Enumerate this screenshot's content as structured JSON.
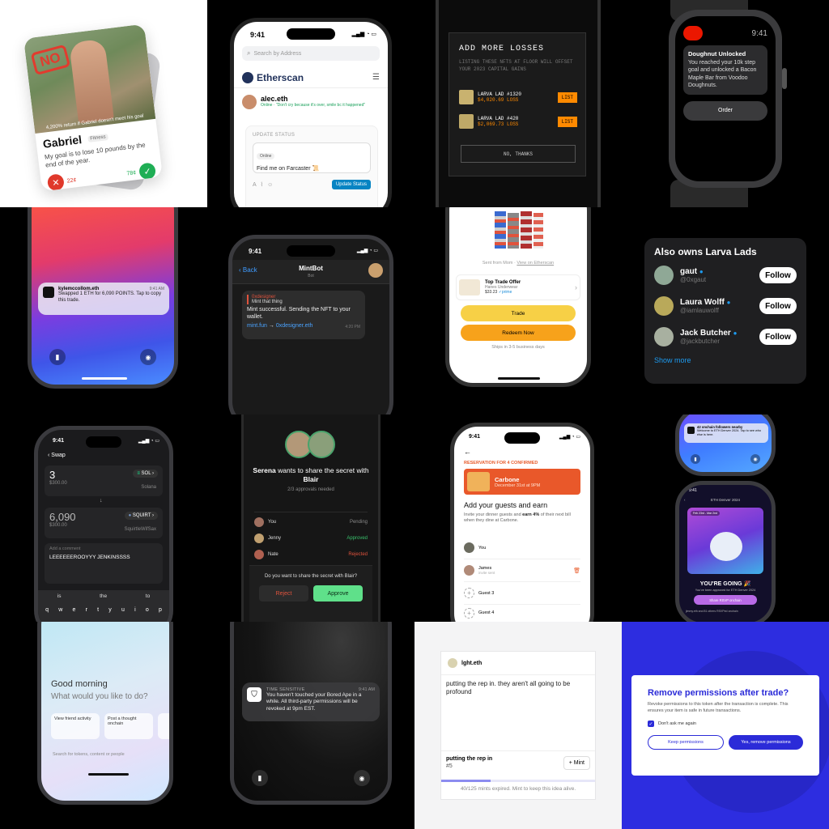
{
  "c1": {
    "stamp": "NO",
    "return_text": "4,200% return if Gabriel doesn't meet his goal",
    "name": "Gabriel",
    "tag": "Fitness",
    "goal": "My goal is to lose 10 pounds by the end of the year.",
    "no_price": "22¢",
    "yes_price": "78¢"
  },
  "c2": {
    "time": "9:41",
    "search_placeholder": "Search by Address",
    "brand": "Etherscan",
    "user": "alec.eth",
    "status_line": "Online · \"Don't cry because it's over, smile bc it happened\"",
    "update_label": "UPDATE STATUS",
    "online_chip": "Online",
    "status_value": "Find me on Farcaster 📜",
    "update_button": "Update Status"
  },
  "c3": {
    "title": "ADD MORE LOSSES",
    "subtitle": "LISTING THESE NFTS AT FLOOR WILL OFFSET YOUR 2023 CAPITAL GAINS",
    "items": [
      {
        "name": "LARVA LAD #1320",
        "loss": "$4,020.69 LOSS",
        "action": "LIST"
      },
      {
        "name": "LARVA LAD #420",
        "loss": "$2,069.73 LOSS",
        "action": "LIST"
      }
    ],
    "decline": "NO, THANKS"
  },
  "c4": {
    "time": "9:41",
    "title": "Doughnut Unlocked",
    "body": "You reached your 10k step goal and unlocked a Bacon Maple Bar from Voodoo Doughnuts.",
    "button": "Order"
  },
  "c5": {
    "sender": "kylemccollom.eth",
    "time": "9:41 AM",
    "message": "Swapped 1 ETH for 6,090 POINTS. Tap to copy this trade."
  },
  "c6": {
    "time": "9:41",
    "back": "Back",
    "title": "MintBot",
    "subtitle": "Bot",
    "quote_author": "0xdesigner",
    "quote_text": "Mint that thing",
    "message": "Mint successful. Sending the NFT to your wallet.",
    "link1": "mint.fun",
    "arrow": "→",
    "link2": "0xdesigner.eth",
    "msg_time": "4:20 PM"
  },
  "c7": {
    "sent_from": "Sent from Mom · ",
    "etherscan_link": "View on Etherscan",
    "offer_title": "Top Trade Offer",
    "offer_item": "Hanes Underwear",
    "offer_price": "$33.23",
    "prime": "✓prime",
    "trade": "Trade",
    "redeem": "Redeem Now",
    "ships": "Ships in 3-5 business days"
  },
  "c8": {
    "title": "Also owns Larva Lads",
    "users": [
      {
        "name": "gaut",
        "handle": "@0xgaut",
        "button": "Follow"
      },
      {
        "name": "Laura Wolff",
        "handle": "@iamlauwolff",
        "button": "Follow"
      },
      {
        "name": "Jack Butcher",
        "handle": "@jackbutcher",
        "button": "Follow"
      }
    ],
    "more": "Show more"
  },
  "c9": {
    "time": "9:41",
    "header": "Swap",
    "from_amount": "3",
    "from_usd": "$300.00",
    "from_token": "SOL",
    "from_token_name": "Solana",
    "to_amount": "6,090",
    "to_usd": "$300.00",
    "to_token": "SQUIRT",
    "to_token_name": "SquirtleWifSax",
    "comment_label": "Add a comment",
    "comment": "LEEEEEEROOYYY JENKINSSSS",
    "suggestions": [
      "is",
      "the",
      "to"
    ],
    "keys": [
      "q",
      "w",
      "e",
      "r",
      "t",
      "y",
      "u",
      "i",
      "o",
      "p"
    ]
  },
  "c10": {
    "requester": "Serena",
    "share_text": " wants to share the secret with ",
    "recipient": "Blair",
    "approvals": "2/3 approvals needed",
    "people": [
      {
        "name": "You",
        "status": "Pending",
        "color": "#8a8a8a"
      },
      {
        "name": "Jenny",
        "status": "Approved",
        "color": "#39c16c"
      },
      {
        "name": "Nate",
        "status": "Rejected",
        "color": "#e0533d"
      }
    ],
    "question": "Do you want to share the secret with Blair?",
    "reject": "Reject",
    "approve": "Approve"
  },
  "c11": {
    "time": "9:41",
    "reservation": "RESERVATION FOR 4 CONFIRMED",
    "venue": "Carbone",
    "date": "December 31st at 9PM",
    "heading": "Add your guests and earn",
    "desc_a": "Invite your dinner guests and ",
    "desc_b": "earn 4%",
    "desc_c": " of their next bill when they dine at Carbone.",
    "guests": [
      {
        "name": "You",
        "sub": ""
      },
      {
        "name": "James",
        "sub": "invite sent"
      },
      {
        "name": "Guest 3",
        "sub": ""
      },
      {
        "name": "Guest 4",
        "sub": ""
      }
    ]
  },
  "c12": {
    "notif": "42 onchain followers nearby",
    "notif_body": "Welcome to ETH Denver 2024. Tap to see who else is here.",
    "time": "9:41",
    "header": "ETH Denver 2024",
    "date_chip": "Feb 23rd - Mar 2nd",
    "going": "YOU'RE GOING 🎉",
    "approved": "You've been approved for ETH Denver 2024",
    "share": "Share RSVP onchain",
    "footer": "jimmy.eth and 81 others RSVPed onchain"
  },
  "c13": {
    "greeting": "Good morning",
    "question": "What would you like to do?",
    "cards": [
      "View friend activity",
      "Post a thought onchain"
    ],
    "search": "Search for tokens, content or people"
  },
  "c14": {
    "label": "TIME SENSITIVE",
    "time": "9:41 AM",
    "message": "You haven't touched your Bored Ape in a while. All third-party permissions will be revoked at 9pm EST."
  },
  "c15": {
    "user": "lght.eth",
    "post": "putting the rep in. they aren't all going to be profound",
    "mint_title": "putting the rep in",
    "mint_no": "#5",
    "mint_button": "Mint",
    "progress": 0.32,
    "expired": "40/125 mints expired. Mint to keep this idea alive."
  },
  "c16": {
    "title": "Remove permissions after trade?",
    "body": "Revoke permissions to this token after the transaction is complete. This ensures your item is safe in future transactions.",
    "checkbox": "Don't ask me again",
    "keep": "Keep permissions",
    "remove": "Yes, remove permissions"
  },
  "colors": {
    "etherscan_blue": "#0784c3",
    "orange": "#ff8a00",
    "accent_blue": "#2b2bd8",
    "twitter_blue": "#1d9bf0"
  }
}
